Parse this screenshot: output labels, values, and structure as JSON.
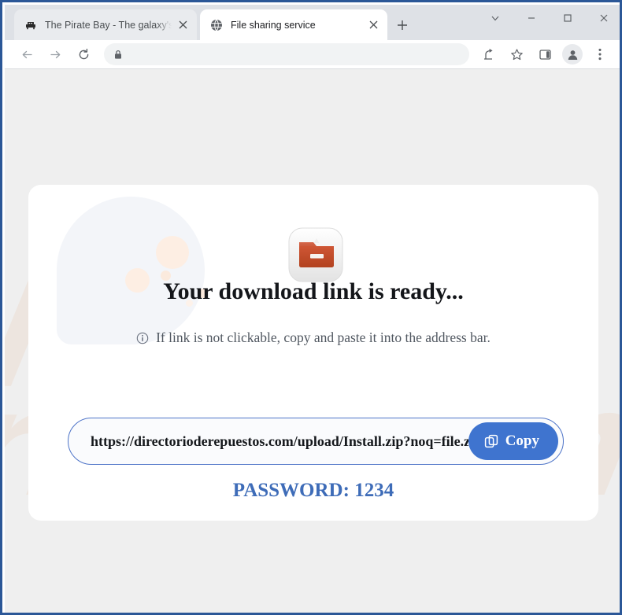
{
  "browser": {
    "tabs": [
      {
        "title": "The Pirate Bay - The galaxy's mos",
        "favicon": "ship-icon",
        "active": false
      },
      {
        "title": "File sharing service",
        "favicon": "globe-icon",
        "active": true
      }
    ],
    "new_tab_label": "+",
    "window_controls": {
      "tab_search": "tab-search-icon",
      "minimize": "minimize-icon",
      "maximize": "maximize-icon",
      "close": "close-icon"
    },
    "toolbar": {
      "back": "back-arrow-icon",
      "forward": "forward-arrow-icon",
      "reload": "reload-icon",
      "address_value": "",
      "address_placeholder": "",
      "lock": "lock-icon",
      "share": "share-icon",
      "bookmark": "star-icon",
      "side_panel": "side-panel-icon",
      "profile": "profile-avatar-icon",
      "menu": "three-dot-menu-icon"
    }
  },
  "page": {
    "watermark_line1": "pc",
    "watermark_line2": "risk.com",
    "file_icon": "zip-archive-icon",
    "filename": "file.zip",
    "headline": "Your download link is ready...",
    "hint_icon": "info-icon",
    "hint_text": "If link is not clickable, copy and paste it into the address bar.",
    "download_url": "https://directorioderepuestos.com/upload/Install.zip?noq=file.zip",
    "copy_button_label": "Copy",
    "copy_button_icon": "copy-icon",
    "password_text": "PASSWORD: 1234"
  },
  "colors": {
    "frame_border": "#2b5797",
    "page_background": "#efefef",
    "card_background": "#ffffff",
    "accent_blue": "#3f74cf",
    "link_blue": "#3a639c",
    "password_blue": "#3e6cb8",
    "zip_icon_orange": "#c9502f",
    "watermark": "#e9c4aa"
  }
}
